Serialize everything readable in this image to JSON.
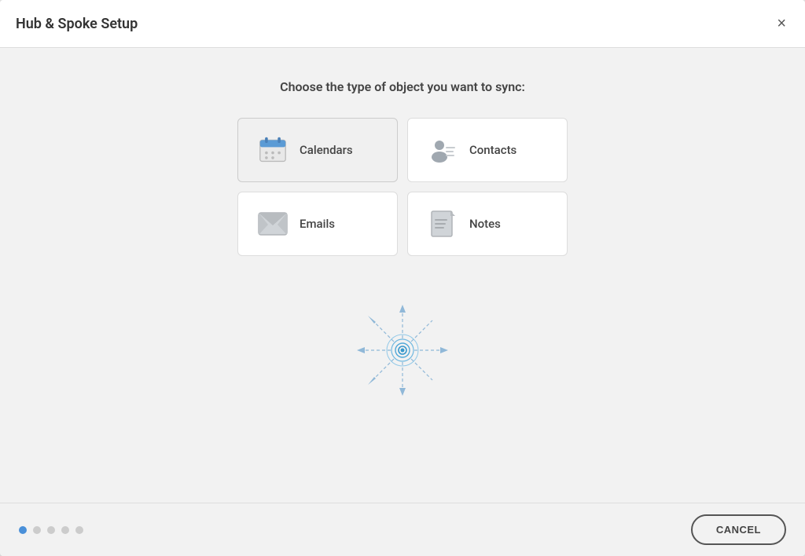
{
  "modal": {
    "title": "Hub & Spoke Setup",
    "close_label": "×"
  },
  "prompt": {
    "text": "Choose the type of object you want to sync:"
  },
  "options": [
    {
      "id": "calendars",
      "label": "Calendars",
      "selected": true
    },
    {
      "id": "contacts",
      "label": "Contacts",
      "selected": false
    },
    {
      "id": "emails",
      "label": "Emails",
      "selected": false
    },
    {
      "id": "notes",
      "label": "Notes",
      "selected": false
    }
  ],
  "footer": {
    "dots": [
      true,
      false,
      false,
      false,
      false
    ],
    "cancel_label": "CANCEL"
  }
}
